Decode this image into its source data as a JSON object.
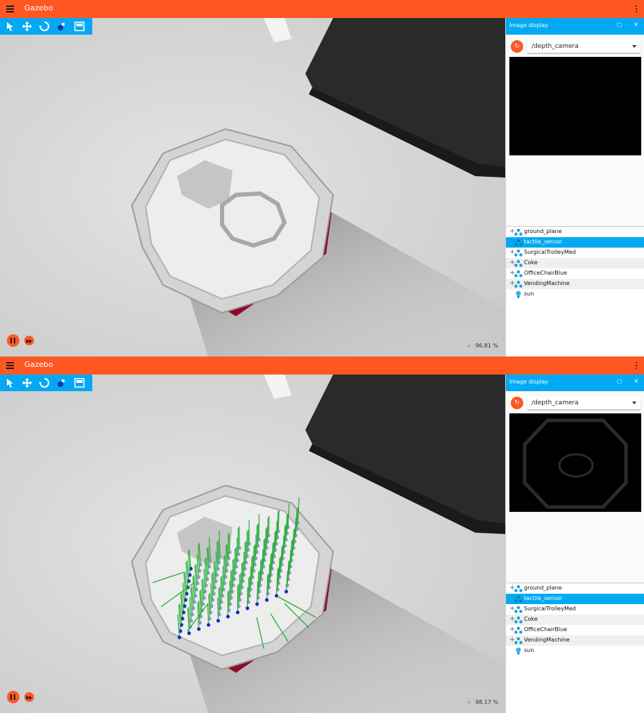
{
  "screens": [
    {
      "app_title": "Gazebo",
      "toolbar_tools": [
        "select-tool-icon",
        "translate-tool-icon",
        "rotate-tool-icon",
        "transform-control-icon",
        "grid-icon"
      ],
      "real_time_factor": "96.81 %",
      "panel": {
        "title": "Image display",
        "topic": "/depth_camera"
      },
      "entities": [
        {
          "label": "ground_plane",
          "icon": "model-icon",
          "expandable": true,
          "selected": false
        },
        {
          "label": "tactile_sensor",
          "icon": "model-icon",
          "expandable": false,
          "selected": true
        },
        {
          "label": "SurgicalTrolleyMed",
          "icon": "model-icon",
          "expandable": true,
          "selected": false
        },
        {
          "label": "Coke",
          "icon": "model-icon",
          "expandable": true,
          "selected": false
        },
        {
          "label": "OfficeChairBlue",
          "icon": "model-icon",
          "expandable": true,
          "selected": false
        },
        {
          "label": "VendingMachine",
          "icon": "model-icon",
          "expandable": true,
          "selected": false
        },
        {
          "label": "sun",
          "icon": "light-bulb-icon",
          "expandable": false,
          "selected": false
        }
      ]
    },
    {
      "app_title": "Gazebo",
      "toolbar_tools": [
        "select-tool-icon",
        "translate-tool-icon",
        "rotate-tool-icon",
        "transform-control-icon",
        "grid-icon"
      ],
      "real_time_factor": "98.17 %",
      "panel": {
        "title": "Image display",
        "topic": "/depth_camera"
      },
      "entities": [
        {
          "label": "ground_plane",
          "icon": "model-icon",
          "expandable": true,
          "selected": false
        },
        {
          "label": "tactile_sensor",
          "icon": "model-icon",
          "expandable": false,
          "selected": true
        },
        {
          "label": "SurgicalTrolleyMed",
          "icon": "model-icon",
          "expandable": true,
          "selected": false
        },
        {
          "label": "Coke",
          "icon": "model-icon",
          "expandable": true,
          "selected": false
        },
        {
          "label": "OfficeChairBlue",
          "icon": "model-icon",
          "expandable": true,
          "selected": false
        },
        {
          "label": "VendingMachine",
          "icon": "model-icon",
          "expandable": true,
          "selected": false
        },
        {
          "label": "sun",
          "icon": "light-bulb-icon",
          "expandable": false,
          "selected": false
        }
      ]
    }
  ],
  "colors": {
    "title_bar": "#ff5722",
    "toolbar": "#03a9f4",
    "selected_row": "#03a9f4",
    "sensor_base": "#9b0d2a",
    "contact_force": "#1fae2f",
    "contact_point": "#1a2fbf"
  }
}
